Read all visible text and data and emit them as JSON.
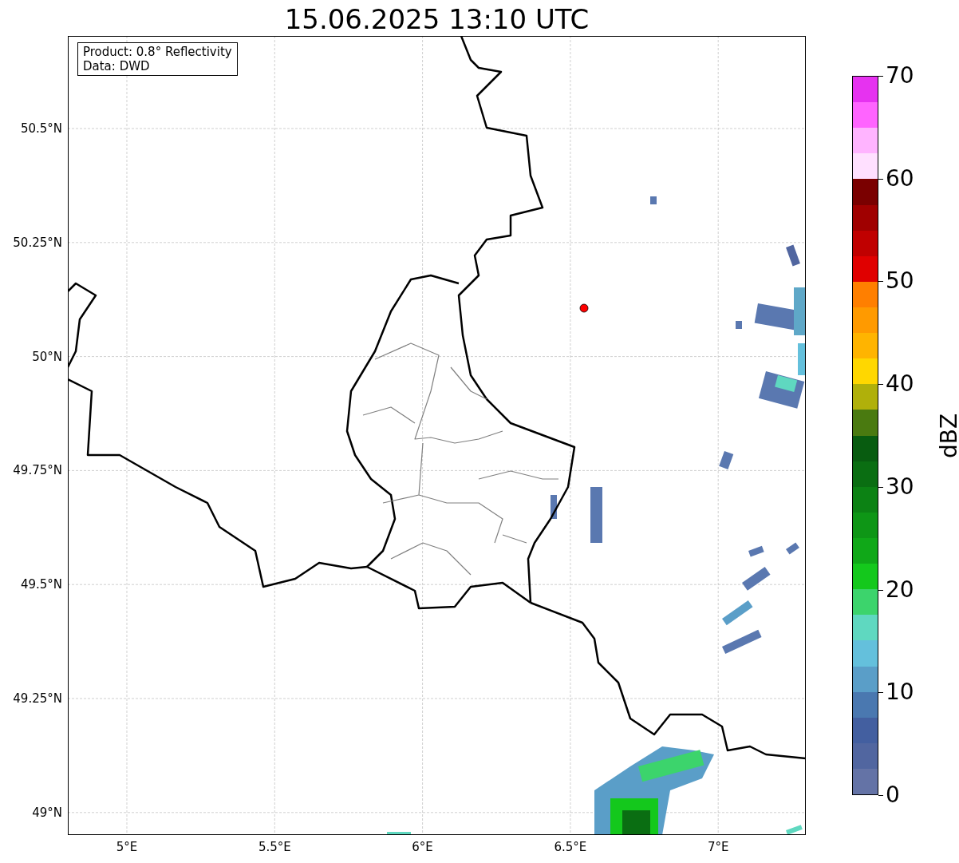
{
  "title": "15.06.2025 13:10 UTC",
  "info_box": [
    "Product: 0.8° Reflectivity",
    "Data: DWD"
  ],
  "map": {
    "lat_labels": [
      "50.5°N",
      "50.25°N",
      "50°N",
      "49.75°N",
      "49.5°N",
      "49.25°N",
      "49°N"
    ],
    "lon_labels": [
      "5°E",
      "5.5°E",
      "6°E",
      "6.5°E",
      "7°E"
    ]
  },
  "colorbar": {
    "label": "dBZ",
    "ticks": [
      "70",
      "60",
      "50",
      "40",
      "30",
      "20",
      "10",
      "0"
    ],
    "bins": [
      {
        "color": "#e632f0"
      },
      {
        "color": "#ff64ff"
      },
      {
        "color": "#ffb4ff"
      },
      {
        "color": "#ffe0ff"
      },
      {
        "color": "#7a0000"
      },
      {
        "color": "#a00000"
      },
      {
        "color": "#c00000"
      },
      {
        "color": "#e00000"
      },
      {
        "color": "#ff7f00"
      },
      {
        "color": "#ff9a00"
      },
      {
        "color": "#ffb400"
      },
      {
        "color": "#ffd700"
      },
      {
        "color": "#b0b00a"
      },
      {
        "color": "#4a7a10"
      },
      {
        "color": "#085c10"
      },
      {
        "color": "#0a6e12"
      },
      {
        "color": "#0c8214"
      },
      {
        "color": "#0e9616"
      },
      {
        "color": "#10a818"
      },
      {
        "color": "#14c81c"
      },
      {
        "color": "#3cd46c"
      },
      {
        "color": "#5fd8c0"
      },
      {
        "color": "#64c0dc"
      },
      {
        "color": "#5a9ec8"
      },
      {
        "color": "#4a78b0"
      },
      {
        "color": "#435fa0"
      },
      {
        "color": "#5166a0"
      },
      {
        "color": "#6473a6"
      }
    ]
  }
}
